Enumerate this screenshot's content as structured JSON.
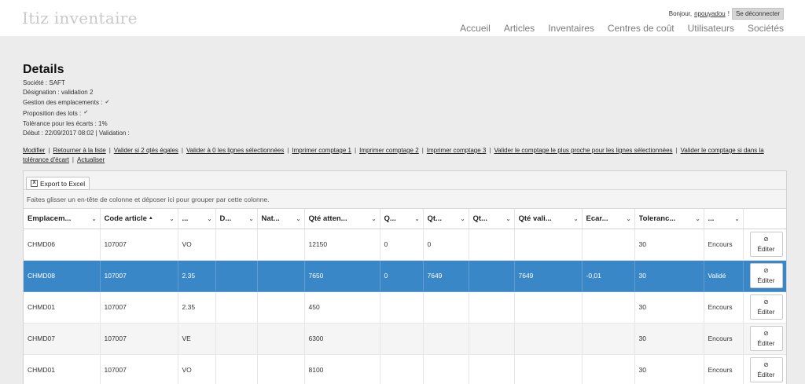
{
  "app": {
    "title": "Itiz inventaire"
  },
  "user": {
    "greeting": "Bonjour,",
    "name": "npouyadou",
    "suffix": "!",
    "logout_label": "Se déconnecter"
  },
  "nav": [
    {
      "label": "Accueil"
    },
    {
      "label": "Articles"
    },
    {
      "label": "Inventaires"
    },
    {
      "label": "Centres de coût"
    },
    {
      "label": "Utilisateurs"
    },
    {
      "label": "Sociétés"
    }
  ],
  "details": {
    "title": "Details",
    "societe": "Société : SAFT",
    "designation": "Désignation : validation 2",
    "gestion": "Gestion des emplacements :",
    "gestion_checked": true,
    "proposition": "Proposition des lots :",
    "proposition_checked": true,
    "tolerance": "Tolérance pour les écarts : 1%",
    "debut": "Début : 22/09/2017 08:02 | Validation :"
  },
  "actions": [
    {
      "label": "Modifier"
    },
    {
      "label": "Retourner à la liste"
    },
    {
      "label": "Valider si 2 qtés égales"
    },
    {
      "label": "Valider à 0 les lignes sélectionnées"
    },
    {
      "label": "Imprimer comptage 1"
    },
    {
      "label": "Imprimer comptage 2"
    },
    {
      "label": "Imprimer comptage 3"
    },
    {
      "label": "Valider le comptage le plus proche pour les lignes sélectionnées"
    },
    {
      "label": "Valider le comptage si dans la tolérance d'écart"
    },
    {
      "label": "Actualiser"
    }
  ],
  "grid": {
    "export_label": "Export to Excel",
    "export_icon": "excel-icon",
    "group_hint": "Faites glisser un en-tête de colonne et déposer ici pour grouper par cette colonne.",
    "selected_color": "#3a87c8",
    "columns": [
      {
        "label": "Emplacem...",
        "sorted": ""
      },
      {
        "label": "Code article",
        "sorted": "▲"
      },
      {
        "label": "...",
        "sorted": ""
      },
      {
        "label": "D...",
        "sorted": ""
      },
      {
        "label": "Nat...",
        "sorted": ""
      },
      {
        "label": "Qté atten...",
        "sorted": ""
      },
      {
        "label": "Q...",
        "sorted": ""
      },
      {
        "label": "Qt...",
        "sorted": ""
      },
      {
        "label": "Qt...",
        "sorted": ""
      },
      {
        "label": "Qté vali...",
        "sorted": ""
      },
      {
        "label": "Ecar...",
        "sorted": ""
      },
      {
        "label": "Toleranc...",
        "sorted": ""
      },
      {
        "label": "...",
        "sorted": ""
      },
      {
        "label": "",
        "sorted": ""
      }
    ],
    "edit_label": "Éditer",
    "rows": [
      {
        "selected": false,
        "cells": [
          "CHMD06",
          "107007",
          "VO",
          "",
          "",
          "12150",
          "0",
          "0",
          "",
          "",
          "",
          "30",
          "Encours"
        ]
      },
      {
        "selected": true,
        "cells": [
          "CHMD08",
          "107007",
          "2.35",
          "",
          "",
          "7650",
          "0",
          "7649",
          "",
          "7649",
          "-0,01",
          "30",
          "Validé"
        ]
      },
      {
        "selected": false,
        "cells": [
          "CHMD01",
          "107007",
          "2.35",
          "",
          "",
          "450",
          "",
          "",
          "",
          "",
          "",
          "30",
          "Encours"
        ]
      },
      {
        "selected": false,
        "cells": [
          "CHMD07",
          "107007",
          "VE",
          "",
          "",
          "6300",
          "",
          "",
          "",
          "",
          "",
          "30",
          "Encours"
        ]
      },
      {
        "selected": false,
        "cells": [
          "CHMD01",
          "107007",
          "VO",
          "",
          "",
          "8100",
          "",
          "",
          "",
          "",
          "",
          "30",
          "Encours"
        ]
      }
    ]
  }
}
